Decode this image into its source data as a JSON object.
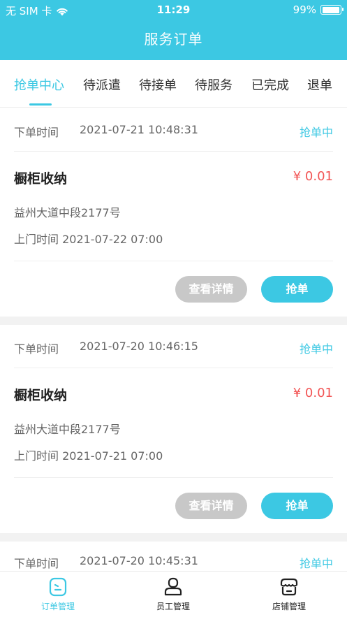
{
  "status_bar": {
    "carrier": "无 SIM 卡",
    "time": "11:29",
    "battery": "99%",
    "battery_level": 0.99
  },
  "header": {
    "title": "服务订单"
  },
  "tabs": [
    {
      "label": "抢单中心",
      "active": true
    },
    {
      "label": "待派遣"
    },
    {
      "label": "待接单"
    },
    {
      "label": "待服务"
    },
    {
      "label": "已完成"
    },
    {
      "label": "退单"
    }
  ],
  "orders": [
    {
      "order_time_label": "下单时间",
      "order_time": "2021-07-21 10:48:31",
      "status": "抢单中",
      "service": "橱柜收纳",
      "price": "¥ 0.01",
      "address": "益州大道中段2177号",
      "visit_time": "上门时间 2021-07-22 07:00",
      "detail_button": "查看详情",
      "grab_button": "抢单"
    },
    {
      "order_time_label": "下单时间",
      "order_time": "2021-07-20 10:46:15",
      "status": "抢单中",
      "service": "橱柜收纳",
      "price": "¥ 0.01",
      "address": "益州大道中段2177号",
      "visit_time": "上门时间 2021-07-21 07:00",
      "detail_button": "查看详情",
      "grab_button": "抢单"
    },
    {
      "order_time_label": "下单时间",
      "order_time": "2021-07-20 10:45:31",
      "status": "抢单中"
    }
  ],
  "bottom_nav": [
    {
      "label": "订单管理",
      "icon": "order-icon",
      "active": true
    },
    {
      "label": "员工管理",
      "icon": "staff-icon"
    },
    {
      "label": "店铺管理",
      "icon": "shop-icon"
    }
  ],
  "colors": {
    "accent": "#3cc8e3",
    "price": "#f25555",
    "disabled_button": "#c8c8c8"
  }
}
